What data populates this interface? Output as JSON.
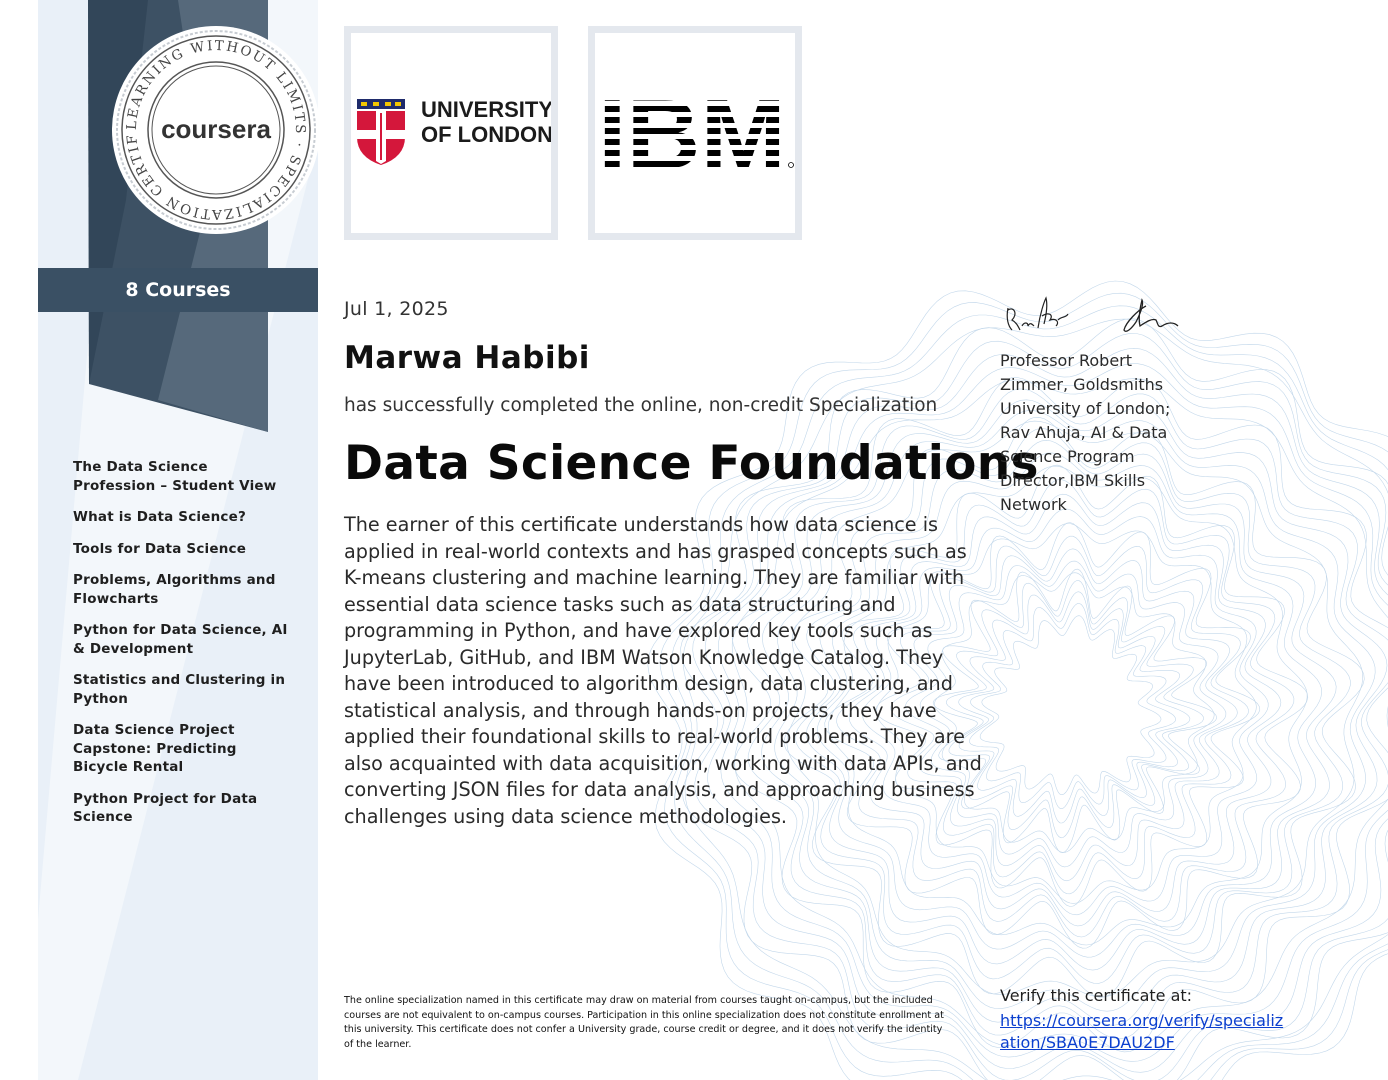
{
  "badge": {
    "ring_text": "LEARNING WITHOUT LIMITS · SPECIALIZATION CERTIFICATE ·",
    "brand": "coursera"
  },
  "sidebar": {
    "course_count": "8 Courses",
    "courses": [
      "The Data Science Profession – Student View",
      "What is Data Science?",
      "Tools for Data Science",
      "Problems, Algorithms and Flowcharts",
      "Python for Data Science, AI & Development",
      "Statistics and Clustering in Python",
      "Data Science Project Capstone: Predicting Bicycle Rental",
      "Python Project for Data Science"
    ]
  },
  "logos": {
    "uol_line1": "UNIVERSITY",
    "uol_line2": "OF LONDON",
    "ibm": "IBM"
  },
  "certificate": {
    "date": "Jul 1, 2025",
    "recipient": "Marwa Habibi",
    "completed_text": "has successfully completed the online, non-credit Specialization",
    "title": "Data Science Foundations",
    "description": "The earner of this certificate understands how data science is applied in real-world contexts and has grasped concepts such as K-means clustering and machine learning. They are familiar with essential data science tasks such as data structuring and programming in Python, and have explored key tools such as JupyterLab, GitHub, and IBM Watson Knowledge Catalog. They have been introduced to algorithm design, data clustering, and statistical analysis, and through hands-on projects, they have applied their foundational skills to real-world problems. They are also acquainted with data acquisition, working with data APIs, and converting JSON files for data analysis, and approaching business challenges using data science methodologies.",
    "disclaimer": "The online specialization named in this certificate may draw on material from courses taught on-campus, but the included courses are not equivalent to on-campus courses. Participation in this online specialization does not constitute enrollment at this university. This certificate does not confer a University grade, course credit or degree, and it does not verify the identity of the learner."
  },
  "signers": {
    "text": "Professor Robert Zimmer, Goldsmiths University of London; Rav Ahuja, AI & Data Science Program Director,IBM Skills Network"
  },
  "verify": {
    "label": "Verify this certificate at:",
    "url": "https://coursera.org/verify/specialization/SBA0E7DAU2DF"
  },
  "colors": {
    "sidebar_bg": "#e9f0f8",
    "ribbon": "#3a5064",
    "link": "#0b3fcf",
    "guilloche": "#bcd3e8"
  }
}
